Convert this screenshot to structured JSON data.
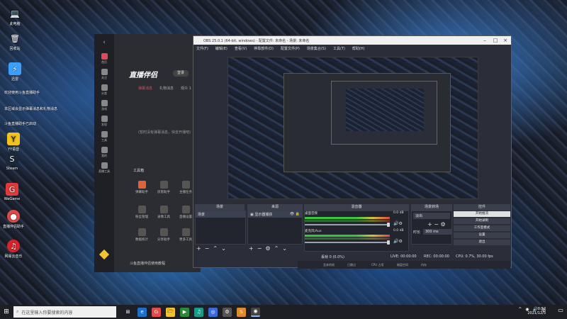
{
  "desktop": {
    "icons": [
      {
        "label": "此电脑",
        "glyph": "💻"
      },
      {
        "label": "回收站",
        "glyph": "🗑"
      },
      {
        "label": "迅雷",
        "glyph": "⚡"
      },
      {
        "label": "YY语音",
        "glyph": "Y"
      },
      {
        "label": "Steam",
        "glyph": "S"
      },
      {
        "label": "WeGame",
        "glyph": "G"
      },
      {
        "label": "直播伴侣助手",
        "glyph": "●"
      },
      {
        "label": "网易云音乐",
        "glyph": "♫"
      }
    ],
    "notes": [
      "欢迎使用斗鱼直播助手",
      "本区域会显示弹幕消息和礼物消息",
      "斗鱼直播助手已启动"
    ]
  },
  "helper": {
    "brand": "直播伴侣",
    "brand_btn": "登录",
    "nav": [
      "首页",
      "关注",
      "分类",
      "游戏",
      "发现",
      "工具",
      "我的",
      "直播工具"
    ],
    "tabs": [
      "弹幕消息",
      "礼物消息",
      "观众 1"
    ],
    "hint": "(暂时没有弹幕消息，快去开播吧)",
    "tools_title": "工具箱",
    "tools": [
      "弹幕助手",
      "房管助手",
      "主播任务",
      "粉丝管理",
      "录像工具",
      "直播设置",
      "数据统计",
      "分享助手",
      "更多工具"
    ],
    "footer": "斗鱼直播伴侣使用教程"
  },
  "obs": {
    "title": "OBS 25.0.1 (64-bit, windows) - 配置文件: 未命名 - 场景: 未命名",
    "menu": [
      "文件(F)",
      "编辑(E)",
      "查看(V)",
      "停靠部件(D)",
      "配置文件(P)",
      "场景集合(S)",
      "工具(T)",
      "帮助(H)"
    ],
    "docks": {
      "scenes": "场景",
      "sources": "来源",
      "mixer": "混音器",
      "transitions": "场景转场",
      "controls": "控件"
    },
    "scene_item": "场景",
    "source_item": "显示器捕获",
    "mixer_tracks": [
      {
        "label": "桌面音频",
        "level": "0.0 dB"
      },
      {
        "label": "麦克风/Aux",
        "level": "0.0 dB"
      }
    ],
    "transition": {
      "type": "淡出",
      "duration_label": "时长",
      "duration": "300 ms"
    },
    "controls": [
      "开始推流",
      "开始录制",
      "工作室模式",
      "设置",
      "退出"
    ],
    "status": {
      "live": "LIVE: 00:00:00",
      "rec": "REC: 00:00:00",
      "cpu": "CPU: 0.7%, 30.00 fps",
      "dropped": "丢帧 0 (0.0%)"
    },
    "footer_items": [
      "丢弃的帧",
      "已跳过",
      "CPU 占用",
      "磁盘空间",
      "内存"
    ]
  },
  "taskbar": {
    "search_placeholder": "在这里输入你要搜索的内容",
    "apps": [
      "⊞",
      "e",
      "G",
      "🗁",
      "▶",
      "♫",
      "◎",
      "⚙",
      "S",
      "◉"
    ],
    "time": "0:52",
    "date": "2021/12/3"
  }
}
